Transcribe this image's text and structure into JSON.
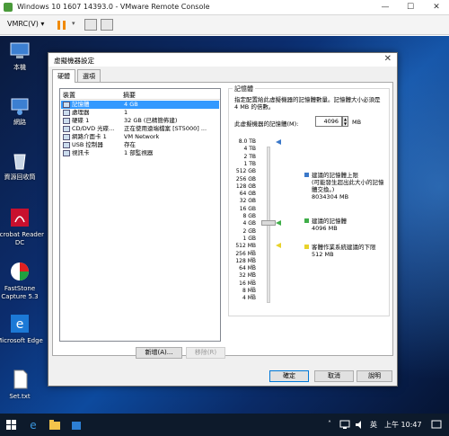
{
  "vmrc": {
    "title": "Windows 10 1607 14393.0 - VMware Remote Console",
    "menu": "VMRC(V)",
    "menu_arrow": "▾",
    "minimize": "—",
    "maximize": "☐",
    "close": "✕"
  },
  "desktop": {
    "icons": [
      {
        "label": "本機",
        "icon": "computer-icon"
      },
      {
        "label": "網路",
        "icon": "network-icon"
      },
      {
        "label": "資源回收筒",
        "icon": "recycle-bin-icon"
      },
      {
        "label": "Acrobat Reader DC",
        "icon": "acrobat-icon"
      },
      {
        "label": "FastStone Capture 5.3",
        "icon": "faststone-icon"
      },
      {
        "label": "Microsoft Edge",
        "icon": "edge-icon"
      },
      {
        "label": "Set.txt",
        "icon": "text-file-icon"
      }
    ]
  },
  "dialog": {
    "title": "虛擬機器設定",
    "close": "✕",
    "tabs": [
      {
        "label": "硬體"
      },
      {
        "label": "選項"
      }
    ],
    "device_list": {
      "col_device": "裝置",
      "col_summary": "摘要",
      "rows": [
        {
          "device": "記憶體",
          "summary": "4 GB",
          "selected": true
        },
        {
          "device": "處理器",
          "summary": "1"
        },
        {
          "device": "硬碟 1",
          "summary": "32 GB (已精簡佈建)"
        },
        {
          "device": "CD/DVD 光碟...",
          "summary": "正在使用遠端檔案 [ST5000] ..."
        },
        {
          "device": "網路介面卡 1",
          "summary": "VM Network"
        },
        {
          "device": "USB 控制器",
          "summary": "存在"
        },
        {
          "device": "視訊卡",
          "summary": "1 部監視器"
        }
      ]
    },
    "buttons": {
      "add": "新增(A)...",
      "remove": "移除(R)",
      "ok": "確定",
      "cancel": "取消",
      "help": "說明"
    },
    "memory": {
      "group_label": "記憶體",
      "description": "指定配置給此虛擬機器的記憶體數量。記憶體大小必須是 4 MB 的倍數。",
      "field_label": "此虛擬機器的記憶體(M):",
      "value": "4096",
      "unit": "MB",
      "scale": [
        "8.0 TB",
        "4 TB",
        "2 TB",
        "1 TB",
        "512 GB",
        "256 GB",
        "128 GB",
        "64 GB",
        "32 GB",
        "16 GB",
        "8 GB",
        "4 GB",
        "2 GB",
        "1 GB",
        "512 MB",
        "256 MB",
        "128 MB",
        "64 MB",
        "32 MB",
        "16 MB",
        "8 MB",
        "4 MB"
      ],
      "legend": {
        "max_label": "建議的記憶體上限",
        "max_note": "(可能發生超出此大小的記憶體交換。)",
        "max_value": "8034304 MB",
        "rec_label": "建議的記憶體",
        "rec_value": "4096 MB",
        "min_label": "客體作業系統建議的下限",
        "min_value": "512 MB"
      },
      "colors": {
        "max": "#3b78c9",
        "rec": "#3fae49",
        "min": "#e8d22a"
      }
    }
  },
  "taskbar": {
    "ime": "英",
    "clock": "上午 10:47"
  }
}
